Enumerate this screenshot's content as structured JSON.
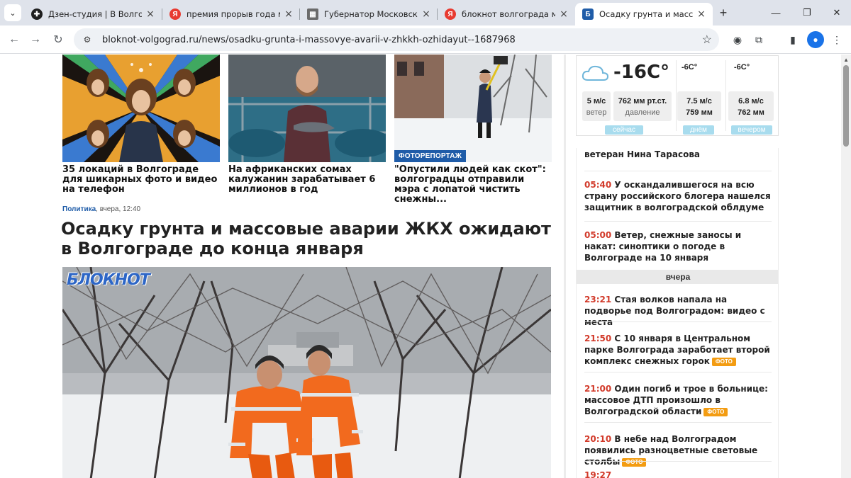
{
  "browser": {
    "tabs": [
      {
        "title": "Дзен-студия | В Волгограде",
        "favicon_letter": "✚",
        "favicon_color": "#1f1f1f"
      },
      {
        "title": "премия прорыв года моск",
        "favicon_letter": "Я",
        "favicon_color": "#e83a30"
      },
      {
        "title": "Губернатор Московской об",
        "favicon_letter": "▦",
        "favicon_color": "#6b6b6b"
      },
      {
        "title": "блокнот волгограда мер пр",
        "favicon_letter": "Я",
        "favicon_color": "#e83a30"
      },
      {
        "title": "Осадку грунта и массовые",
        "favicon_letter": "Б",
        "favicon_color": "#1f5ca8",
        "active": true
      }
    ],
    "url": "bloknot-volgograd.ru/news/osadku-grunta-i-massovye-avarii-v-zhkkh-ozhidayut--1687968"
  },
  "related": [
    {
      "title": "35 локаций в Волгограде для шикарных фото и видео на телефон"
    },
    {
      "title": "На африканских сомах калужанин зарабатывает 6 миллионов в год"
    },
    {
      "title": "\"Опустили людей как скот\": волгоградцы отправили мэра с лопатой чистить снежны...",
      "badge": "ФОТОРЕПОРТАЖ"
    }
  ],
  "article": {
    "category": "Политика",
    "time": ", вчера, 12:40",
    "title": "Осадку грунта и массовые аварии ЖКХ ожидают в Волгограде до конца января",
    "logo": "БЛОКНОТ"
  },
  "weather": {
    "now": {
      "temp": "-16C°",
      "wind": "5 м/с",
      "wind_label": "ветер",
      "pressure": "762 мм рт.ст.",
      "pressure_label": "давление",
      "label": "сейчас"
    },
    "day": {
      "temp": "-6C°",
      "wind": "7.5 м/с",
      "pressure": "759 мм",
      "label": "днём"
    },
    "evening": {
      "temp": "-6C°",
      "wind": "6.8 м/с",
      "pressure": "762 мм",
      "label": "вечером"
    }
  },
  "feed": {
    "items": [
      {
        "time": "",
        "text": "ветеран Нина Тарасова",
        "foto": ""
      },
      {
        "time": "05:40",
        "text": "У оскандалившегося на всю страну российского блогера нашелся защитник в волгоградской облдуме",
        "foto": ""
      },
      {
        "time": "05:00",
        "text": "Ветер, снежные заносы и накат: синоптики о погоде в Волгограде на 10 января",
        "foto": ""
      },
      {
        "time": "23:21",
        "text": "Стая волков напала на подворье под Волгоградом: видео с места",
        "foto": ""
      },
      {
        "time": "21:50",
        "text": "С 10 января в Центральном парке Волгограда заработает второй комплекс снежных горок",
        "foto": "ФОТО"
      },
      {
        "time": "21:00",
        "text": "Один погиб и трое в больнице: массовое ДТП произошло в Волгоградской области",
        "foto": "ФОТО"
      },
      {
        "time": "20:10",
        "text": "В небе над Волгоградом появились разноцветные световые столбы",
        "foto": "ФОТО"
      },
      {
        "time": "19:27",
        "text": "",
        "foto": ""
      }
    ],
    "day_separator": "вчера"
  },
  "colors": {
    "accent": "#1f5ca8",
    "time_red": "#d23a2a",
    "foto_badge": "#f39c12",
    "weather_pill": "#a8dcee"
  }
}
